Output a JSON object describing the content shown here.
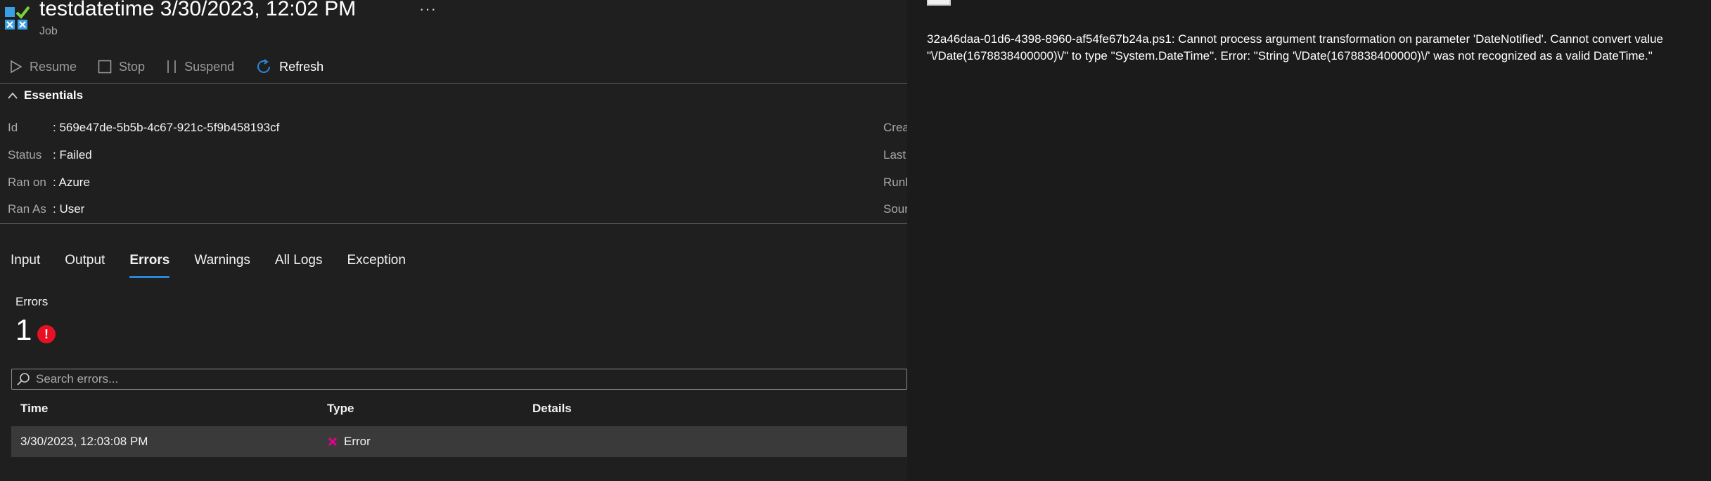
{
  "header": {
    "title": "testdatetime 3/30/2023, 12:02 PM",
    "more": "···",
    "subtitle": "Job",
    "icon": "runbook-job-icon"
  },
  "toolbar": {
    "resume": "Resume",
    "stop": "Stop",
    "suspend": "Suspend",
    "refresh": "Refresh"
  },
  "essentials": {
    "toggle_label": "Essentials",
    "rows": [
      {
        "label": "Id",
        "value": ": 569e47de-5b5b-4c67-921c-5f9b458193cf"
      },
      {
        "label": "Status",
        "value": ": Failed"
      },
      {
        "label": "Ran on",
        "value": ": Azure"
      },
      {
        "label": "Ran As",
        "value": ": User"
      }
    ],
    "right_labels": [
      "Crea",
      "Last",
      "Runl",
      "Sour"
    ]
  },
  "tabs": [
    {
      "label": "Input"
    },
    {
      "label": "Output"
    },
    {
      "label": "Errors"
    },
    {
      "label": "Warnings"
    },
    {
      "label": "All Logs"
    },
    {
      "label": "Exception"
    }
  ],
  "errors": {
    "label": "Errors",
    "count": "1",
    "badge": "!",
    "search_placeholder": "Search errors...",
    "columns": {
      "time": "Time",
      "type": "Type",
      "details": "Details"
    },
    "rows": [
      {
        "time": "3/30/2023, 12:03:08 PM",
        "type": "Error",
        "details": ""
      }
    ]
  },
  "detail": {
    "message": "32a46daa-01d6-4398-8960-af54fe67b24a.ps1: Cannot process argument transformation on parameter 'DateNotified'. Cannot convert value \"\\/Date(1678838400000)\\/\" to type \"System.DateTime\". Error: \"String '\\/Date(1678838400000)\\/' was not recognized as a valid DateTime.\""
  },
  "colors": {
    "accent": "#2b88d8",
    "error": "#e81123",
    "error_x": "#e3008c",
    "background": "#1f1f1f"
  }
}
